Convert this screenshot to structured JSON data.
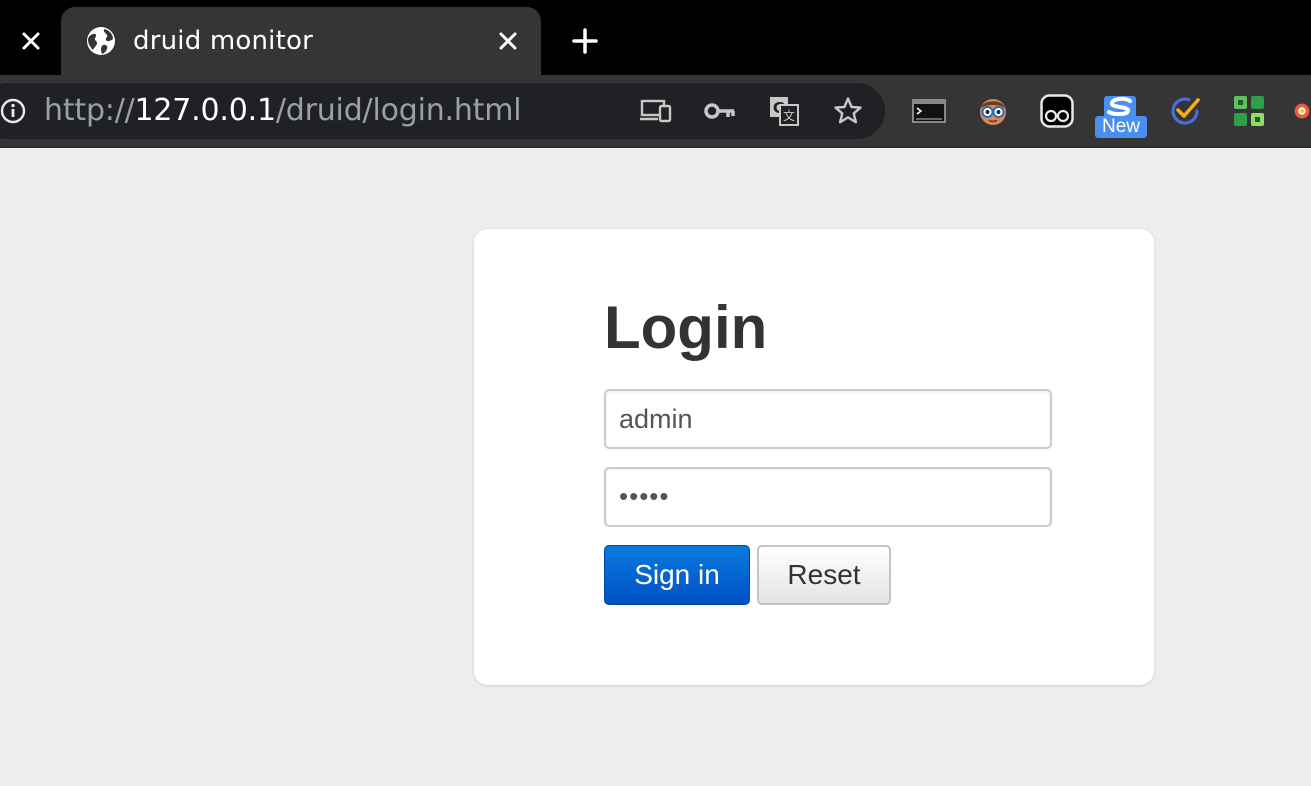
{
  "browser": {
    "tab": {
      "title": "druid monitor",
      "icon": "globe-icon"
    },
    "address_bar": {
      "scheme": "http://",
      "host": "127.0.0.1",
      "path": "/druid/login.html"
    },
    "extensions": {
      "badge_new": "New"
    },
    "colors": {
      "tabstrip": "#000000",
      "active_tab": "#353535",
      "omnibox": "#202124"
    }
  },
  "login": {
    "title": "Login",
    "username_value": "admin",
    "password_value": "•••••",
    "signin_label": "Sign in",
    "reset_label": "Reset"
  },
  "colors": {
    "page_background": "#ededed",
    "card_background": "#ffffff",
    "primary_button": "#0a66d8"
  }
}
